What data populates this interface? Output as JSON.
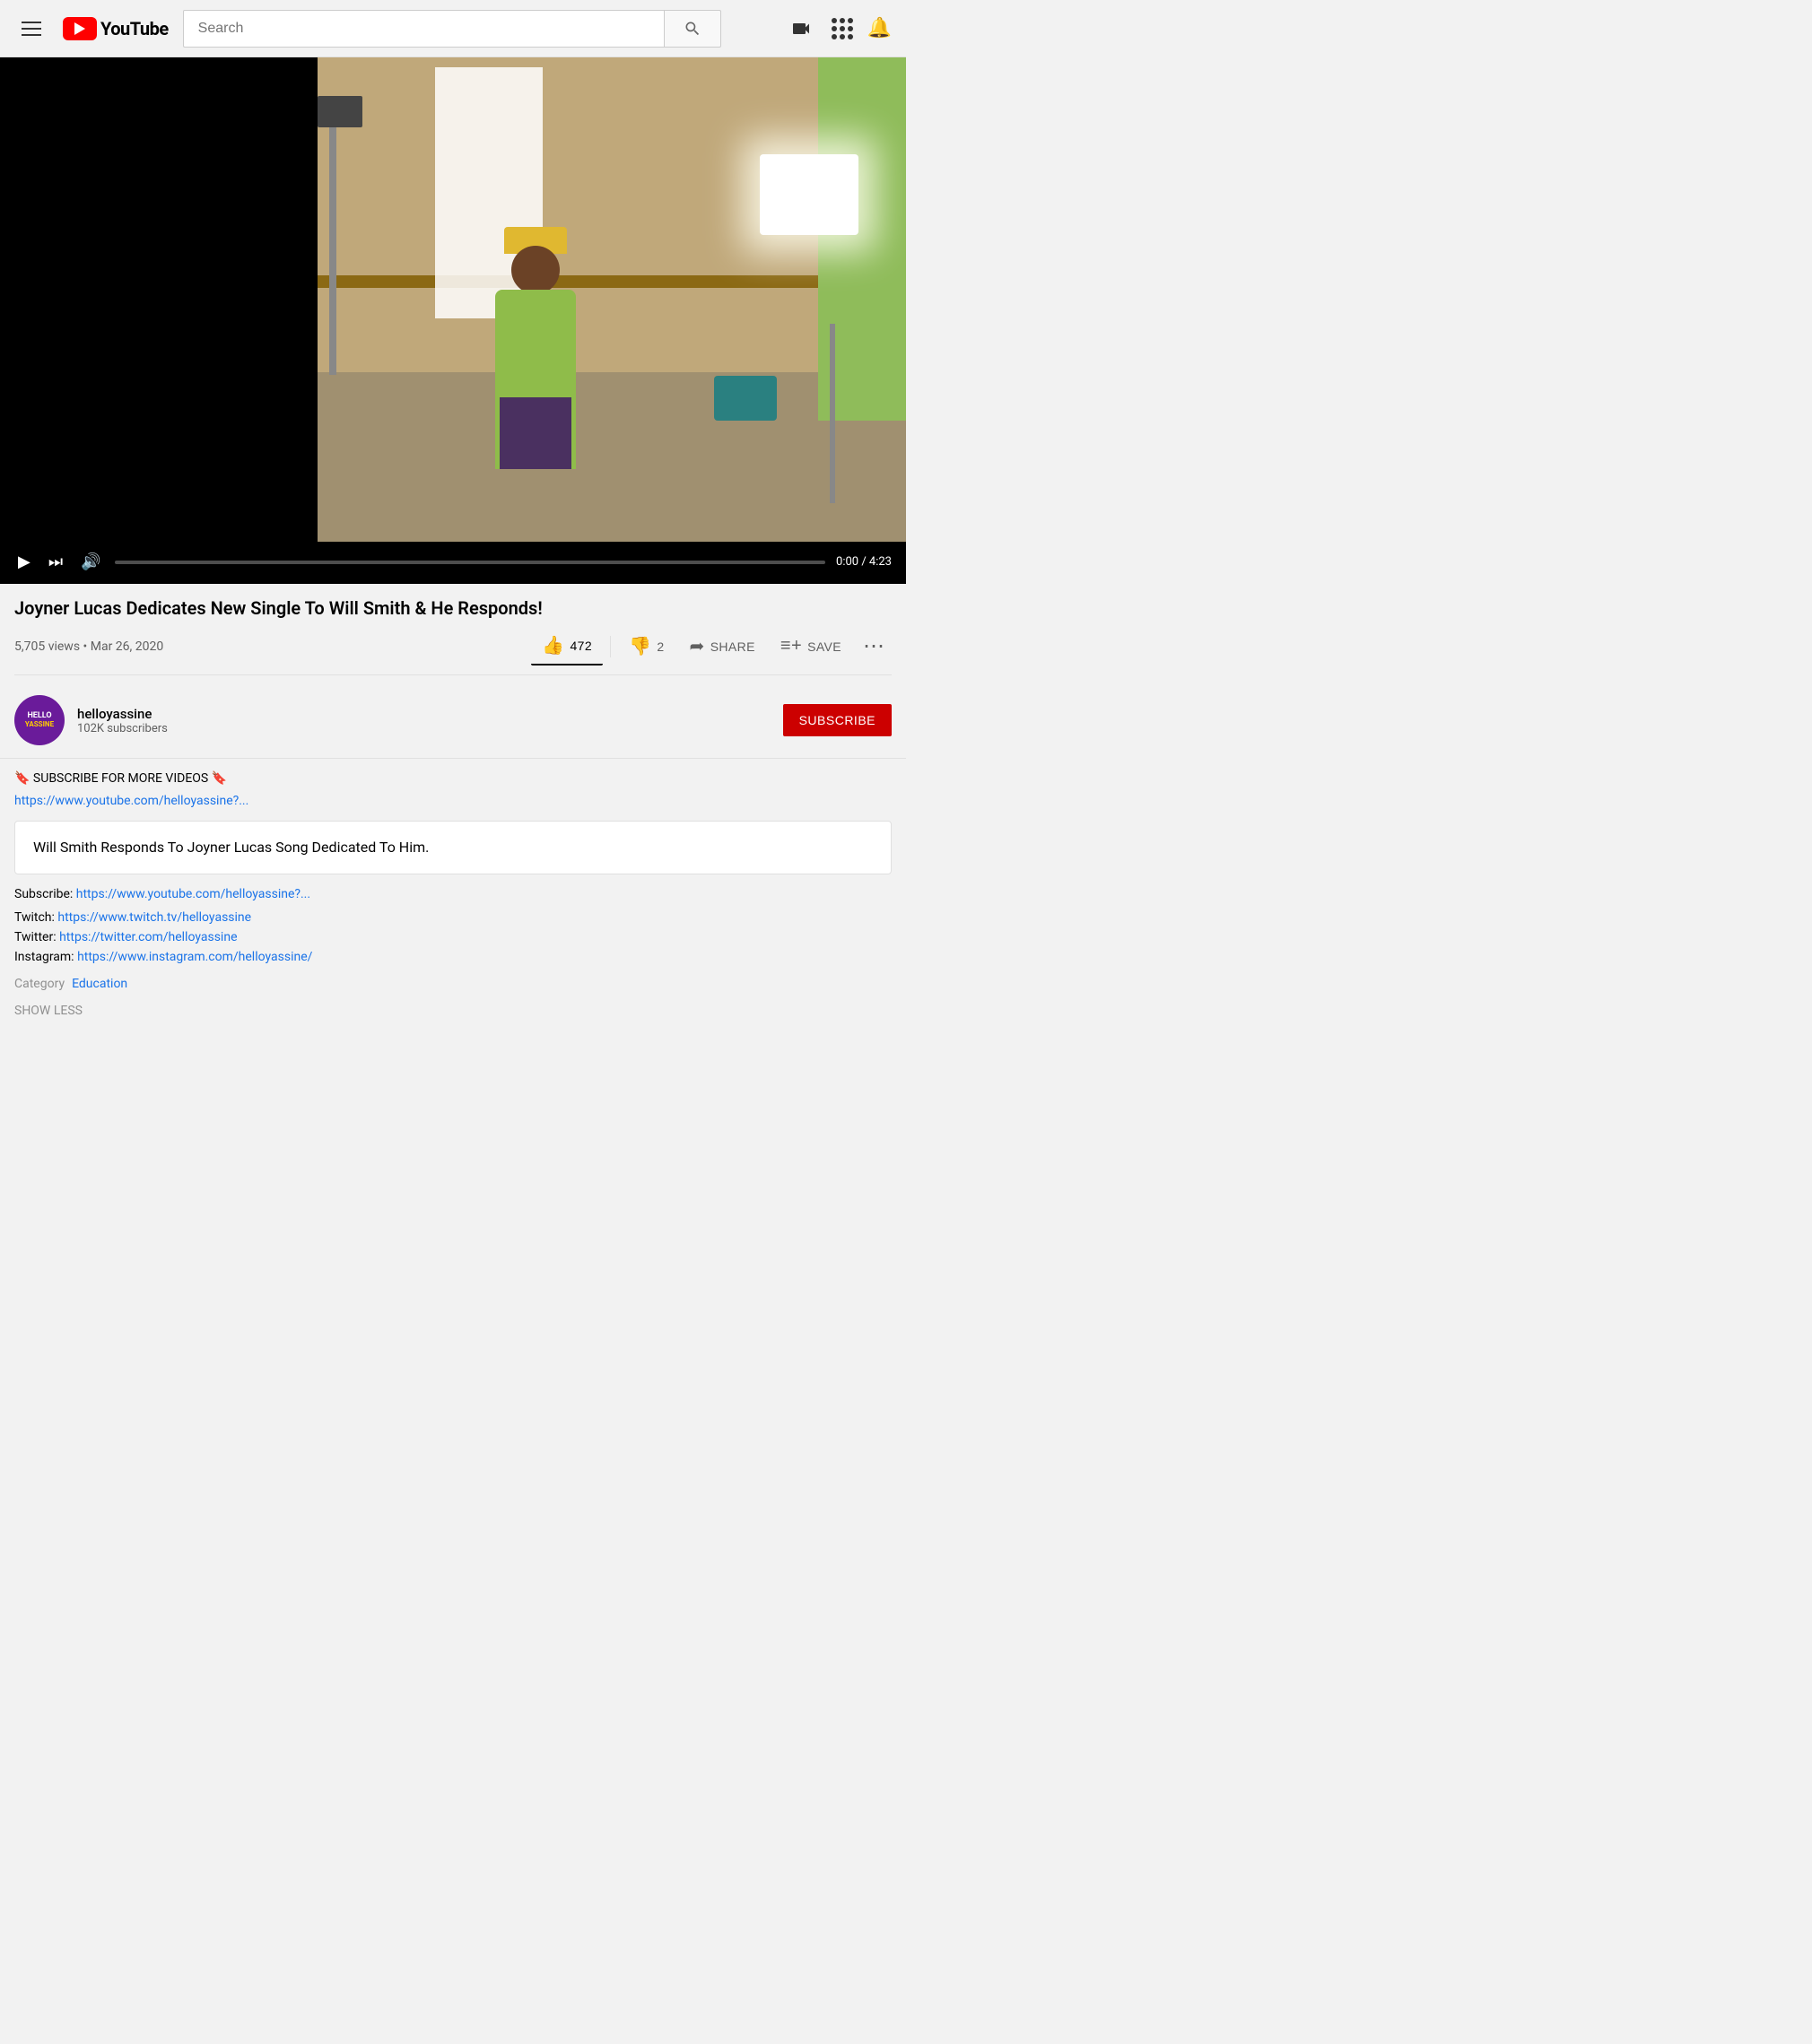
{
  "header": {
    "logo_text": "YouTube",
    "search_placeholder": "Search",
    "hamburger_label": "Menu",
    "upload_label": "Upload",
    "apps_label": "Apps",
    "notifications_label": "Notifications"
  },
  "video": {
    "title": "Joyner Lucas Dedicates New Single To Will Smith & He Responds!",
    "views": "5,705 views",
    "date": "Mar 26, 2020",
    "duration": "4:23",
    "current_time": "0:00",
    "likes": "472",
    "dislikes": "2",
    "share_label": "SHARE",
    "save_label": "SAVE"
  },
  "channel": {
    "name": "helloyassine",
    "subscribers": "102K subscribers",
    "avatar_line1": "HELLO",
    "avatar_line2": "YASSINE",
    "subscribe_label": "SUBSCRIBE"
  },
  "description": {
    "subscribe_emoji": "🔖",
    "subscribe_text": " SUBSCRIBE FOR MORE VIDEOS 🔖",
    "channel_link": "https://www.youtube.com/helloyassine?...",
    "highlight": "Will Smith Responds To Joyner Lucas Song Dedicated To Him.",
    "subscribe_label": "Subscribe:",
    "subscribe_link": "https://www.youtube.com/helloyassine?...",
    "twitch_label": "Twitch: ",
    "twitch_link": "https://www.twitch.tv/helloyassine",
    "twitter_label": "Twitter: ",
    "twitter_link": "https://twitter.com/helloyassine",
    "instagram_label": "Instagram: ",
    "instagram_link": "https://www.instagram.com/helloyassine/",
    "category_label": "Category",
    "category_value": "Education",
    "show_less": "SHOW LESS"
  }
}
